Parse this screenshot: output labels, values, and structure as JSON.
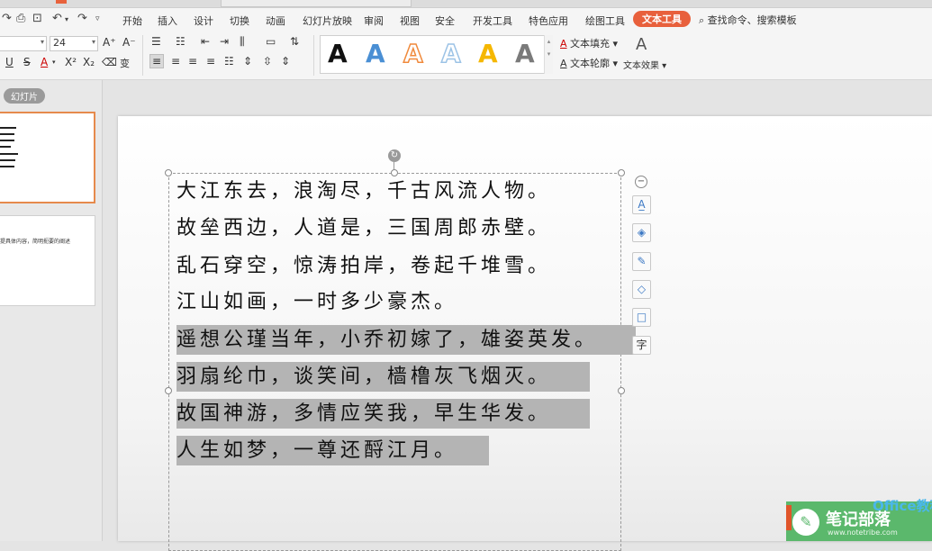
{
  "menu": {
    "items": [
      "开始",
      "插入",
      "设计",
      "切换",
      "动画",
      "幻灯片放映",
      "审阅",
      "视图",
      "安全",
      "开发工具",
      "特色应用",
      "绘图工具"
    ],
    "active": "文本工具",
    "search": "查找命令、搜索模板"
  },
  "ribbon": {
    "font_size": "24",
    "grow_font": "A⁺",
    "shrink_font": "A⁻",
    "underline": "U",
    "strike": "S",
    "font_color": "A",
    "superscript": "X²",
    "subscript": "X₂",
    "gallery": [
      {
        "letter": "A",
        "color": "#111111"
      },
      {
        "letter": "A",
        "color": "#4a8fd4"
      },
      {
        "letter": "A",
        "color": "#f08a3c"
      },
      {
        "letter": "A",
        "color": "#9cc3e6"
      },
      {
        "letter": "A",
        "color": "#f5b700"
      },
      {
        "letter": "A",
        "color": "#7a7a7a"
      }
    ],
    "text_fill": "文本填充",
    "text_outline": "文本轮廓",
    "text_effect": "文本效果"
  },
  "sidebar": {
    "tab": "幻灯片",
    "slide2_text": "提具体内容，简明扼要的阐述"
  },
  "slide": {
    "lines": [
      {
        "text": "大江东去，浪淘尽，千古风流人物。",
        "selected": false
      },
      {
        "text": "故垒西边，人道是，三国周郎赤壁。",
        "selected": false
      },
      {
        "text": "乱石穿空，惊涛拍岸，卷起千堆雪。",
        "selected": false
      },
      {
        "text": "江山如画，一时多少豪杰。",
        "selected": false
      },
      {
        "text": "遥想公瑾当年，小乔初嫁了，雄姿英发。",
        "selected": true
      },
      {
        "text": "羽扇纶巾，谈笑间，樯橹灰飞烟灭。",
        "selected": true
      },
      {
        "text": "故国神游，多情应笑我，早生华发。",
        "selected": true
      },
      {
        "text": "人生如梦，一尊还酹江月。",
        "selected": true
      }
    ]
  },
  "float_toolbar": {
    "text_icon": "字"
  },
  "watermark": {
    "title": "笔记部落",
    "subtitle": "www.notetribe.com",
    "overlay": "Office教程网"
  }
}
